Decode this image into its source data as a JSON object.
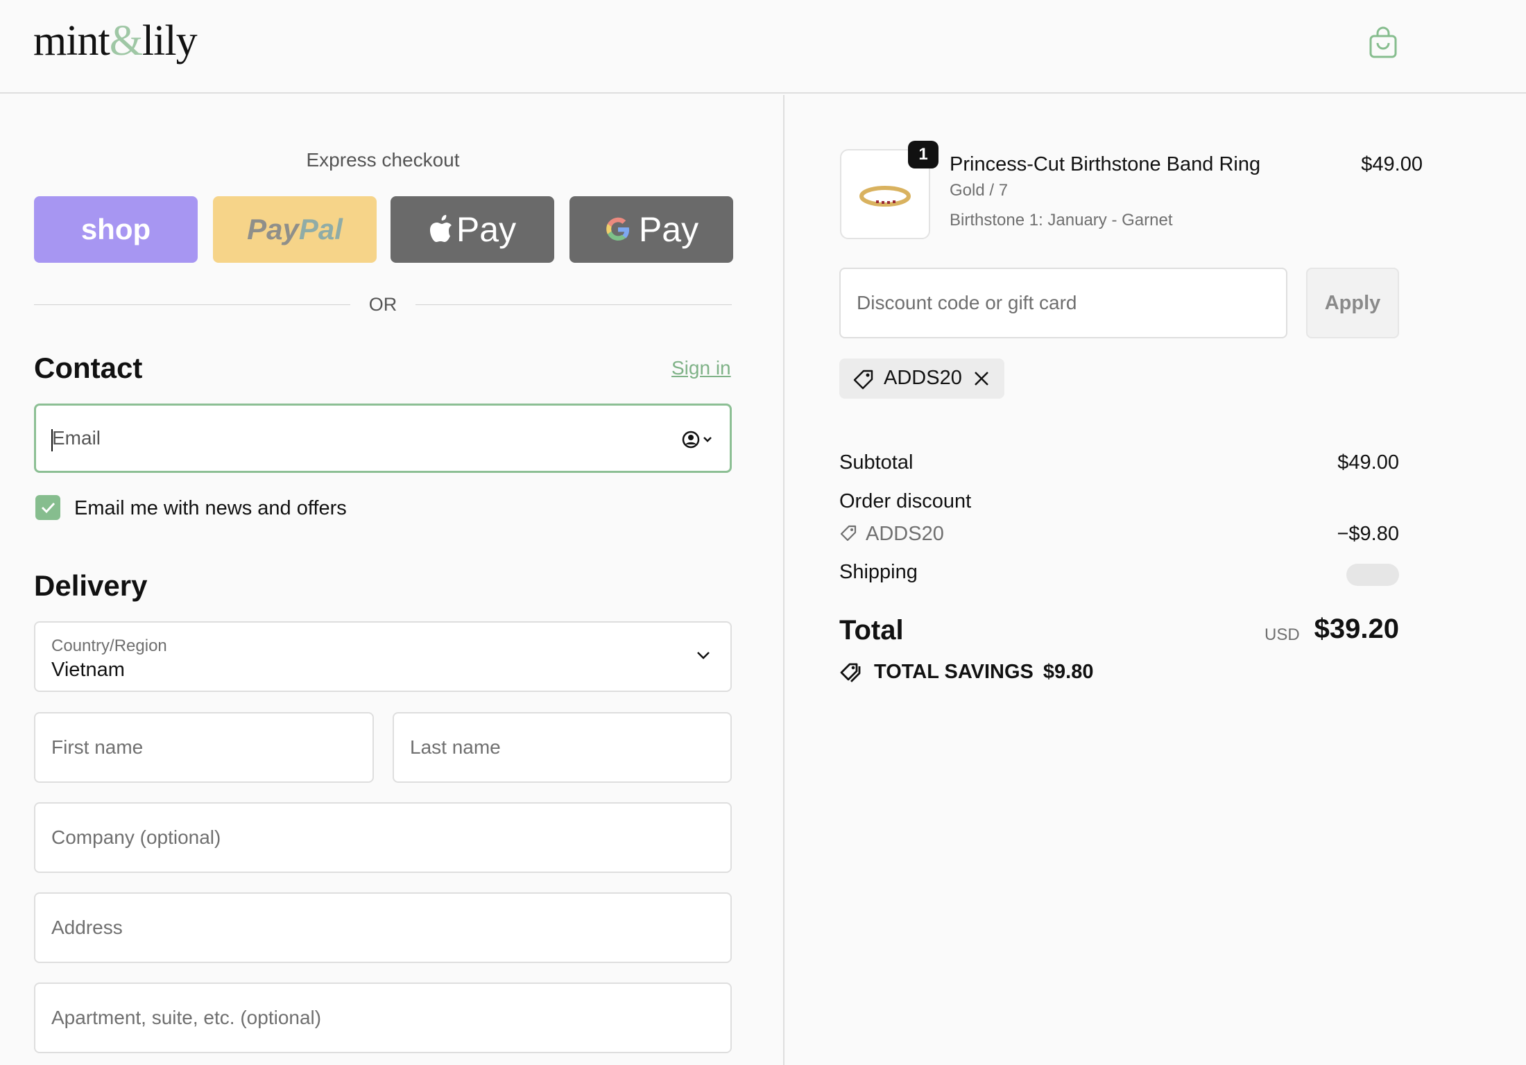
{
  "brand": {
    "logo_left": "mint",
    "logo_amp": "&",
    "logo_right": "lily"
  },
  "colors": {
    "accent": "#8cbf94",
    "shop": "#a796f2",
    "paypal": "#f6d489",
    "wallet": "#6a6a6a",
    "link": "#7fb287"
  },
  "express": {
    "label": "Express checkout",
    "shop": "shop",
    "paypal_1": "Pay",
    "paypal_2": "Pal",
    "apple": "Pay",
    "gpay": "Pay",
    "or": "OR"
  },
  "contact": {
    "title": "Contact",
    "sign_in": "Sign in",
    "email_placeholder": "Email",
    "newsletter_label": "Email me with news and offers",
    "newsletter_checked": true
  },
  "delivery": {
    "title": "Delivery",
    "country_label": "Country/Region",
    "country_value": "Vietnam",
    "first_name": "First name",
    "last_name": "Last name",
    "company": "Company (optional)",
    "address": "Address",
    "apartment": "Apartment, suite, etc. (optional)"
  },
  "cart": {
    "quantity": "1",
    "product_name": "Princess-Cut Birthstone Band Ring",
    "variant": "Gold / 7",
    "option": "Birthstone 1: January - Garnet",
    "price": "$49.00"
  },
  "discount": {
    "placeholder": "Discount code or gift card",
    "apply": "Apply",
    "applied_code": "ADDS20"
  },
  "summary": {
    "subtotal_label": "Subtotal",
    "subtotal_value": "$49.00",
    "order_discount_label": "Order discount",
    "discount_code": "ADDS20",
    "discount_value": "−$9.80",
    "shipping_label": "Shipping",
    "total_label": "Total",
    "currency": "USD",
    "total_value": "$39.20",
    "savings_label": "TOTAL SAVINGS",
    "savings_value": "$9.80"
  }
}
